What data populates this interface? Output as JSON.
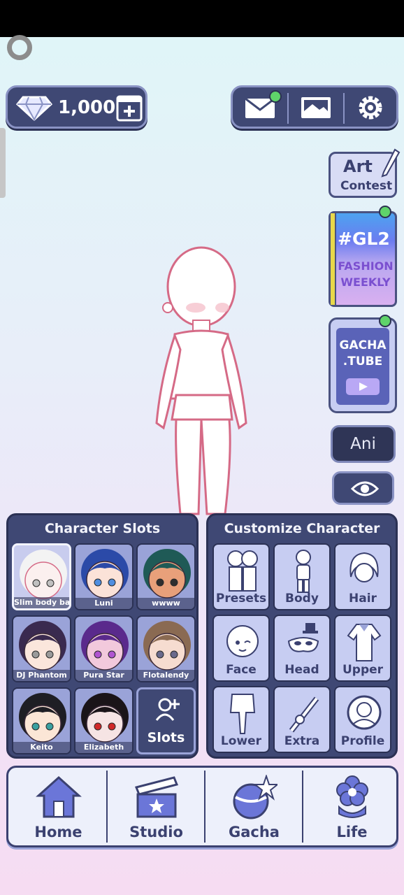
{
  "header": {
    "gem_count": "1,000"
  },
  "side": {
    "art_contest_line1": "Art",
    "art_contest_line2": "Contest",
    "fashion_tag": "#GL2",
    "fashion_line1": "FASHION",
    "fashion_line2": "WEEKLY",
    "tube_line1": "GACHA",
    "tube_line2": ".TUBE",
    "ani_label": "Ani"
  },
  "character_slots": {
    "title": "Character Slots",
    "slots": [
      {
        "name": "Slim body bas",
        "hair": "#f3f3f3",
        "skin": "#fbf0ef",
        "eye": "#c0c0c0"
      },
      {
        "name": "Luni",
        "hair": "#2b4aa8",
        "skin": "#fbe2d8",
        "eye": "#4f8ee0"
      },
      {
        "name": "wwww",
        "hair": "#1f5a56",
        "skin": "#e8a07a",
        "eye": "#2e2e2e"
      },
      {
        "name": "DJ Phantom",
        "hair": "#3a2a4f",
        "skin": "#fbe6dc",
        "eye": "#9a9a9a"
      },
      {
        "name": "Pura Star",
        "hair": "#5a2a8c",
        "skin": "#f2c9dc",
        "eye": "#b055d0"
      },
      {
        "name": "Flotalendy",
        "hair": "#8a6a52",
        "skin": "#f6dcd0",
        "eye": "#6a6a8c"
      },
      {
        "name": "Keito",
        "hair": "#1e1e24",
        "skin": "#fbe6d6",
        "eye": "#3aa0a0"
      },
      {
        "name": "Elizabeth",
        "hair": "#1a1418",
        "skin": "#f6e4e4",
        "eye": "#d02828"
      }
    ],
    "add_label": "Slots"
  },
  "customize": {
    "title": "Customize Character",
    "buttons": [
      "Presets",
      "Body",
      "Hair",
      "Face",
      "Head",
      "Upper",
      "Lower",
      "Extra",
      "Profile"
    ]
  },
  "nav": {
    "items": [
      "Home",
      "Studio",
      "Gacha",
      "Life"
    ]
  },
  "colors": {
    "panel": "#3f4874",
    "accent_green": "#5fd36a"
  }
}
